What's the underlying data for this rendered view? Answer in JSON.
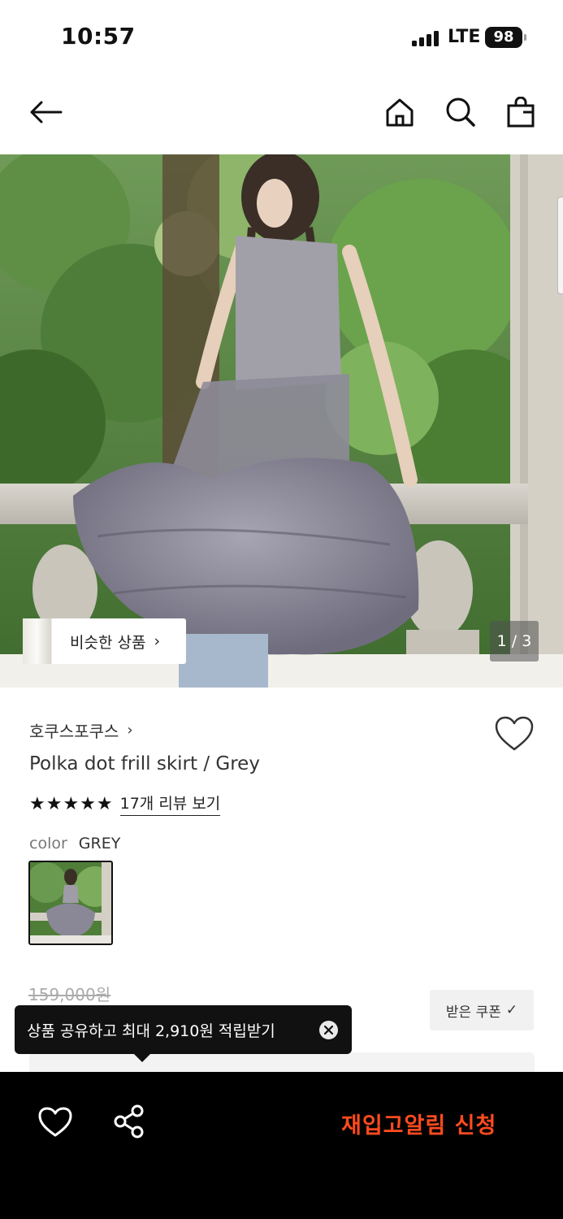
{
  "status_bar": {
    "time": "10:57",
    "network": "LTE",
    "battery": "98"
  },
  "nav": {
    "back_icon": "arrow-left-icon",
    "home_icon": "home-icon",
    "search_icon": "search-icon",
    "bag_icon": "shopping-bag-icon"
  },
  "hero": {
    "similar_label": "비슷한 상품",
    "similar_chevron": "›",
    "page_indicator": "1 / 3"
  },
  "product": {
    "brand": "호쿠스포쿠스",
    "brand_chevron": "›",
    "title": "Polka dot frill skirt / Grey",
    "stars": "★★★★★",
    "rating_value": 5,
    "review_link": "17개 리뷰 보기",
    "option_label": "color",
    "option_value": "GREY",
    "original_price": "159,000원",
    "coupon_label": "받은 쿠폰",
    "coupon_check": "✓"
  },
  "tooltip": {
    "text": "상품 공유하고 최대 2,910원 적립받기"
  },
  "bottom_bar": {
    "wish_icon": "heart-icon",
    "share_icon": "share-icon",
    "restock_label": "재입고알림 신청"
  },
  "colors": {
    "accent": "#ff4b1f",
    "bottom_bar_bg": "#000000",
    "tooltip_bg": "#111111",
    "coupon_bg": "#f1f1f1"
  }
}
